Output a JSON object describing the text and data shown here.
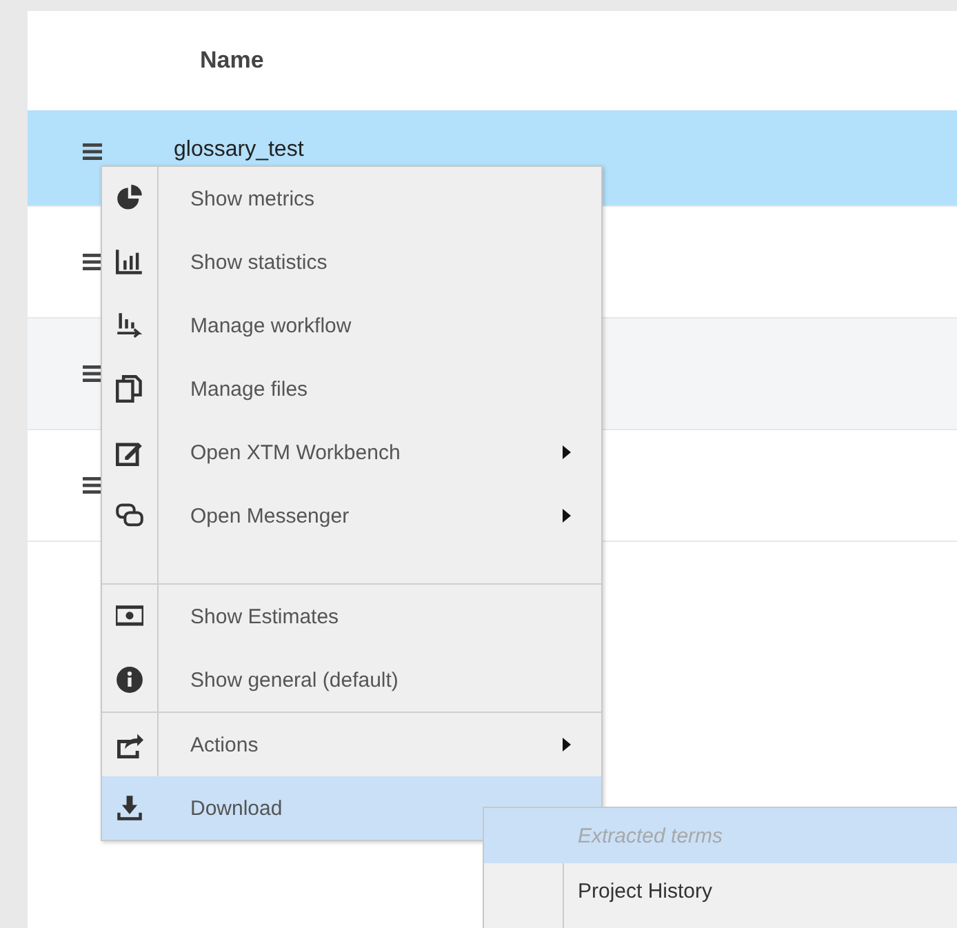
{
  "table": {
    "columns": [
      "Name"
    ],
    "rows": [
      {
        "name": "glossary_test",
        "selected": true,
        "shade": false
      },
      {
        "name": "",
        "selected": false,
        "shade": false
      },
      {
        "name": "",
        "selected": false,
        "shade": true
      },
      {
        "name": "",
        "selected": false,
        "shade": false
      }
    ]
  },
  "context_menu": {
    "groups": [
      [
        {
          "label": "Show metrics",
          "submenu": false,
          "selected": false
        },
        {
          "label": "Show statistics",
          "submenu": false,
          "selected": false
        },
        {
          "label": "Manage workflow",
          "submenu": false,
          "selected": false
        },
        {
          "label": "Manage files",
          "submenu": false,
          "selected": false
        },
        {
          "label": "Open XTM Workbench",
          "submenu": true,
          "selected": false
        },
        {
          "label": "Open Messenger",
          "submenu": true,
          "selected": false
        }
      ],
      [
        {
          "label": "Show Estimates",
          "submenu": false,
          "selected": false
        },
        {
          "label": "Show general (default)",
          "submenu": false,
          "selected": false
        }
      ],
      [
        {
          "label": "Actions",
          "submenu": true,
          "selected": false
        },
        {
          "label": "Download",
          "submenu": false,
          "selected": true
        }
      ]
    ]
  },
  "submenu": {
    "items": [
      {
        "label": "Extracted terms",
        "disabled": true,
        "selected": true
      },
      {
        "label": "Project History",
        "disabled": false,
        "selected": false
      }
    ]
  }
}
